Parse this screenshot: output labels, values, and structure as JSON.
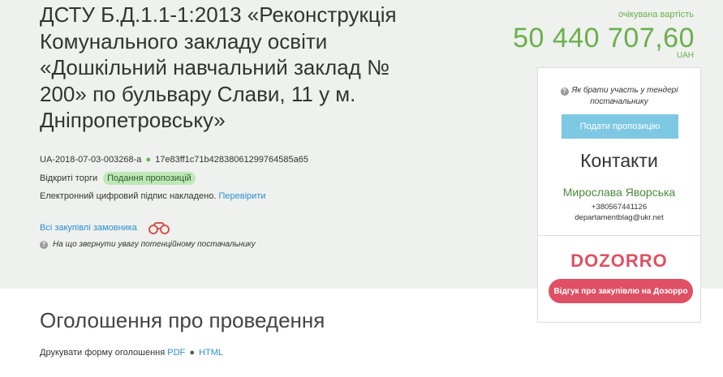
{
  "tender": {
    "title": "ДСТУ Б.Д.1.1-1:2013 «Реконструкція Комунального закладу освіти «Дошкільний навчальний заклад № 200» по бульвару Слави, 11 у м. Дніпропетровську»",
    "id": "UA-2018-07-03-003268-a",
    "hash": "17e83ff1c71b42838061299764585a65",
    "procedure_type": "Відкриті торги",
    "status_badge": "Подання пропозицій",
    "signature_text": "Електронний цифровий підпис накладено.",
    "verify_link": "Перевірити",
    "all_purchases_link": "Всі закупівлі замовника",
    "hint_text": "На що звернути увагу потенційному постачальнику"
  },
  "price": {
    "label": "очікувана вартість",
    "amount": "50 440 707,60",
    "currency": "UAH"
  },
  "sidebar": {
    "how_to_participate": "Як брати участь у тендері постачальнику",
    "submit_button": "Подати пропозицію",
    "contacts_title": "Контакти",
    "contact_name": "Мирослава Яворська",
    "contact_phone": "+380567441126",
    "contact_email": "departamentblag@ukr.net",
    "logo_text": "DOZORRO",
    "feedback_button": "Відгук про закупівлю на Дозорро"
  },
  "announcement": {
    "heading": "Оголошення про проведення",
    "print_text": "Друкувати форму оголошення",
    "pdf_link": "PDF",
    "html_link": "HTML"
  },
  "colors": {
    "accent_green": "#6ab04c",
    "link_blue": "#2d8ed1",
    "dozorro_red": "#e05064",
    "submit_blue": "#7ec8e3",
    "top_bg": "#eef1ee"
  }
}
